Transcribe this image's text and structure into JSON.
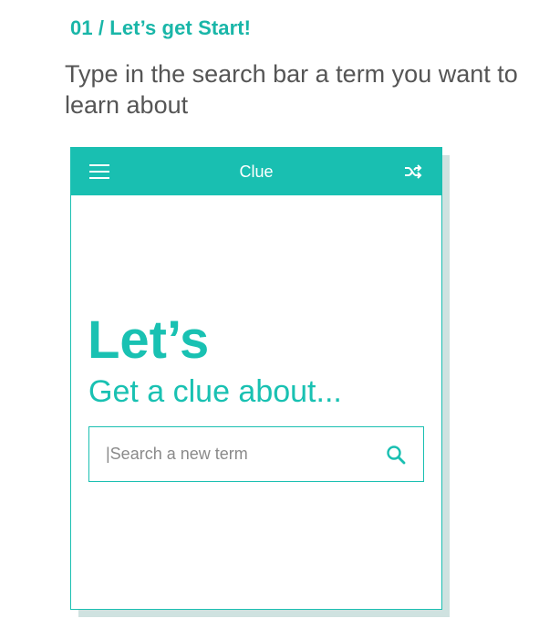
{
  "header": {
    "step_title": "01 / Let’s get Start!",
    "instruction": "Type in the search bar a term you want to learn about"
  },
  "app": {
    "title": "Clue",
    "menu_icon": "hamburger-menu-icon",
    "shuffle_icon": "shuffle-icon",
    "hero_title": "Let’s",
    "hero_subtitle": "Get a clue about...",
    "search": {
      "placeholder": "|Search a new term",
      "value": "",
      "icon": "search-icon"
    }
  },
  "colors": {
    "accent": "#19bfb1",
    "text": "#555555",
    "shadow": "#cfe2e0"
  }
}
